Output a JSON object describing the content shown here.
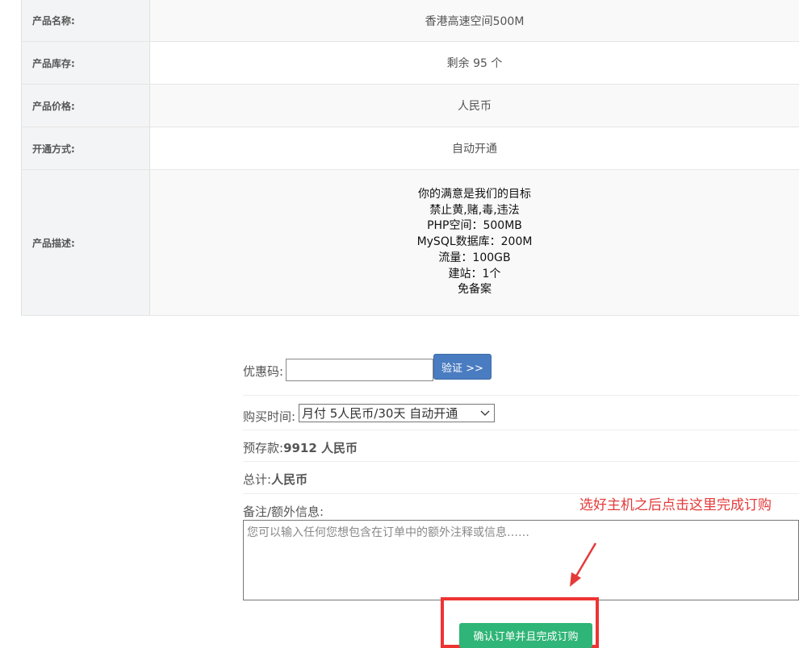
{
  "product": {
    "rows": [
      {
        "label": "产品名称:",
        "value": "香港高速空间500M"
      },
      {
        "label": "产品库存:",
        "value": "剩余 95 个"
      },
      {
        "label": "产品价格:",
        "value": "人民币"
      },
      {
        "label": "开通方式:",
        "value": "自动开通"
      }
    ],
    "description": {
      "label": "产品描述:",
      "lines": [
        "你的满意是我们的目标",
        "禁止黄,赌,毒,违法",
        "PHP空间：500MB",
        "MySQL数据库：200M",
        "流量：100GB",
        "建站：1个",
        "免备案"
      ]
    }
  },
  "order": {
    "coupon_label": "优惠码:",
    "coupon_value": "",
    "verify_label": "验证 >>",
    "period_label": "购买时间:",
    "period_selected": "月付 5人民币/30天 自动开通",
    "deposit_label": "预存款:",
    "deposit_value": "9912 人民币",
    "total_label": "总计:",
    "total_value": "人民币",
    "notes_label": "备注/额外信息:",
    "notes_placeholder": "您可以输入任何您想包含在订单中的额外注释或信息……",
    "submit_label": "确认订单并且完成订购"
  },
  "annotation": {
    "text": "选好主机之后点击这里完成订购",
    "color": "#e43a3a"
  },
  "colors": {
    "verify_button": "#4a7cc1",
    "submit_button": "#2fb577",
    "highlight_box": "#ee3333"
  }
}
